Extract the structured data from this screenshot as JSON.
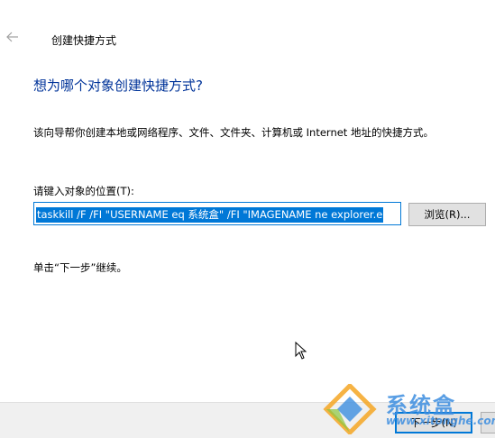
{
  "header": {
    "back_icon": "left-arrow-icon",
    "title": "创建快捷方式"
  },
  "main": {
    "heading": "想为哪个对象创建快捷方式?",
    "description": "该向导帮你创建本地或网络程序、文件、文件夹、计算机或 Internet 地址的快捷方式。",
    "location_label": "请键入对象的位置(T):",
    "location_value": "taskkill /F /FI \"USERNAME eq 系统盒\" /FI \"IMAGENAME ne explorer.e",
    "browse_label": "浏览(R)...",
    "hint": "单击“下一步”继续。"
  },
  "footer": {
    "next_label": "下一步(N)"
  },
  "watermark": {
    "name": "系统盒",
    "url": "www.xitonghe.com"
  },
  "colors": {
    "heading": "#003399",
    "selection": "#0078d7",
    "button_face": "#e1e1e1",
    "footer_bg": "#f0f0f0",
    "watermark": "#3d8ee0"
  }
}
